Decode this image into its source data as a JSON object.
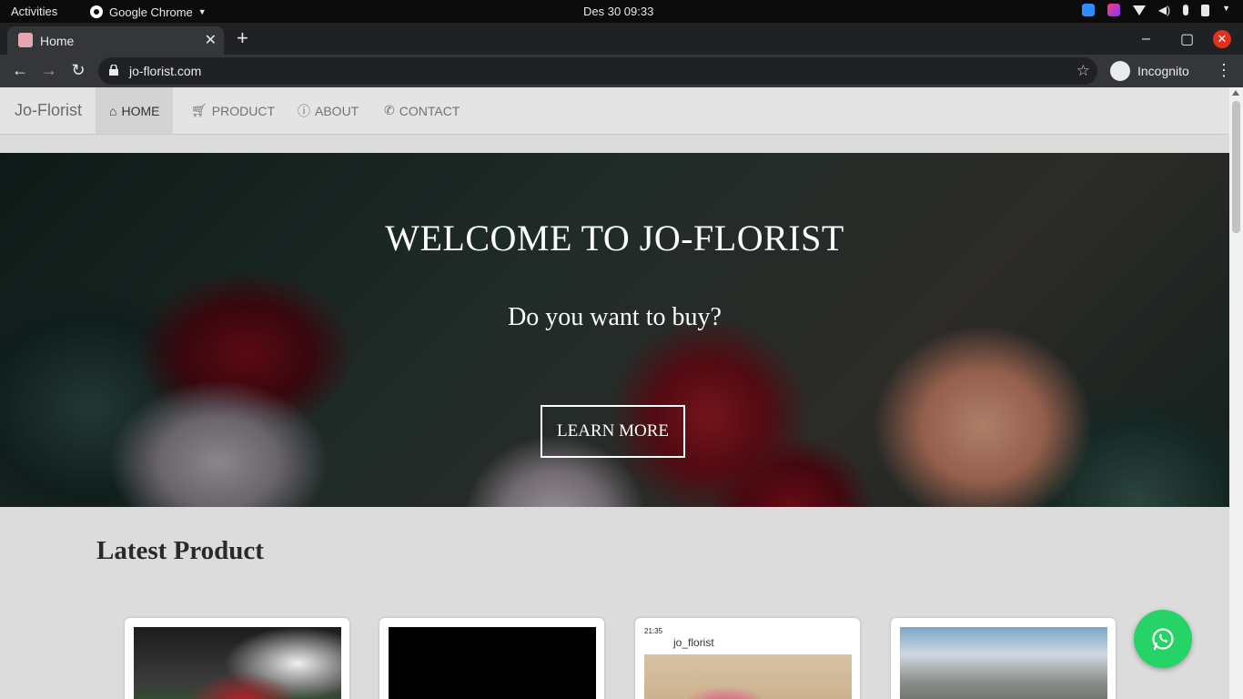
{
  "os": {
    "activities": "Activities",
    "app_name": "Google Chrome",
    "clock": "Des 30  09:33"
  },
  "browser": {
    "tab_title": "Home",
    "url": "jo-florist.com",
    "profile": "Incognito"
  },
  "site": {
    "brand": "Jo-Florist",
    "nav": [
      {
        "label": "HOME",
        "icon": "home-icon",
        "active": true
      },
      {
        "label": "PRODUCT",
        "icon": "cart-icon",
        "active": false
      },
      {
        "label": "ABOUT",
        "icon": "info-icon",
        "active": false
      },
      {
        "label": "CONTACT",
        "icon": "phone-icon",
        "active": false
      }
    ],
    "hero": {
      "title": "WELCOME TO JO-FLORIST",
      "subtitle": "Do you want to buy?",
      "button": "LEARN MORE"
    },
    "section_title": "Latest Product",
    "product3": {
      "status_time": "21:35",
      "account": "jo_florist"
    }
  },
  "colors": {
    "whatsapp": "#25d366",
    "close_button": "#e0301e"
  }
}
